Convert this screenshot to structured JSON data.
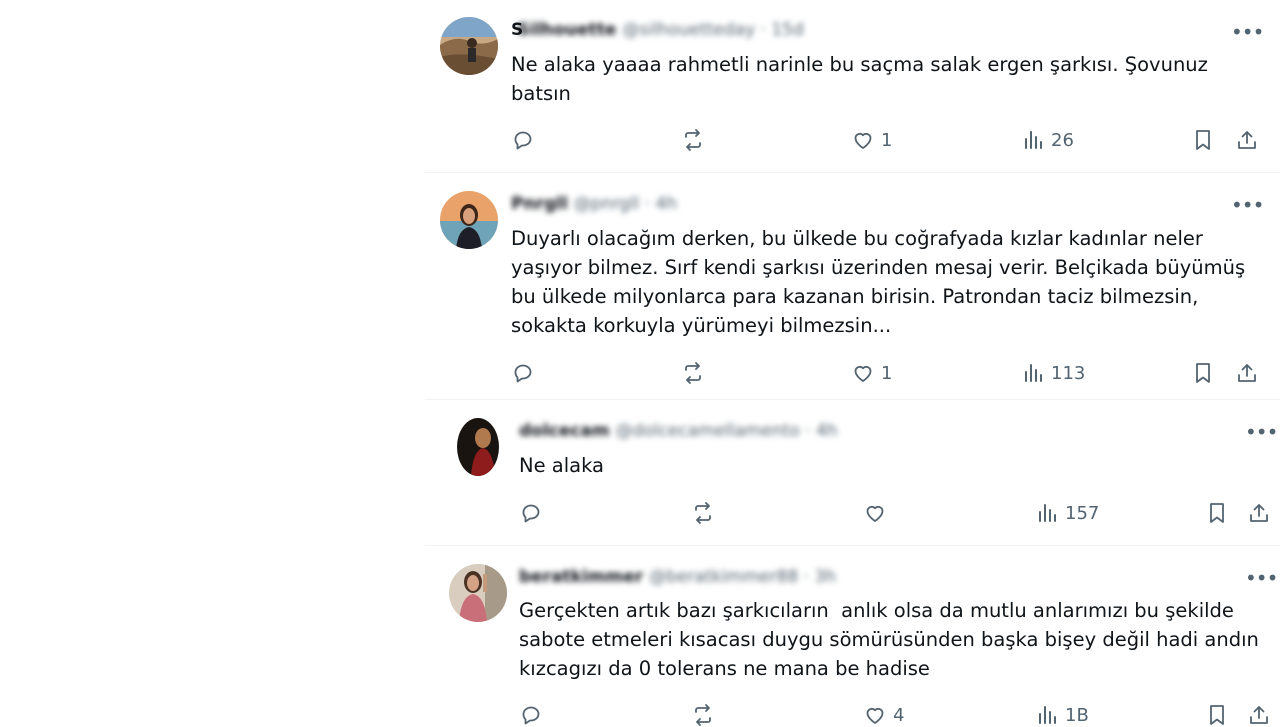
{
  "tweets": [
    {
      "name_visible": "S",
      "name_blurred": "Silhouette",
      "handle_blurred": "@silhouetteday · 15d",
      "text": "Ne alaka yaaaa rahmetli narinle bu saçma salak ergen şarkısı. Şovunuz\nbatsın",
      "likes": "1",
      "views": "26",
      "avatar_icon": "avatar-landscape"
    },
    {
      "name_blurred": "Pnrgll",
      "handle_blurred": "@pnrgll · 4h",
      "text": "Duyarlı olacağım derken, bu ülkede bu coğrafyada kızlar kadınlar neler\nyaşıyor bilmez. Sırf kendi şarkısı üzerinden mesaj verir. Belçikada büyümüş\nbu ülkede milyonlarca para kazanan birisin. Patrondan taciz bilmezsin,\nsokakta korkuyla yürümeyi bilmezsin...",
      "likes": "1",
      "views": "113",
      "avatar_icon": "avatar-portrait"
    },
    {
      "name_blurred": "dolcecam",
      "handle_blurred": "@dolcecamellamento · 4h",
      "text": "Ne alaka",
      "likes": "",
      "views": "157",
      "avatar_icon": "avatar-dark"
    },
    {
      "name_blurred": "beratkimmer",
      "handle_blurred": "@beratkimmer88 · 3h",
      "text": "Gerçekten artık bazı şarkıcıların  anlık olsa da mutlu anlarımızı bu şekilde\nsabote etmeleri kısacası duygu sömürüsünden başka bişey değil hadi andın\nkızcagızı da 0 tolerans ne mana be hadise",
      "likes": "4",
      "views": "1B",
      "avatar_icon": "avatar-selfie"
    }
  ],
  "colors": {
    "text": "#0f1419",
    "muted": "#536471",
    "divider": "#eff3f4"
  }
}
